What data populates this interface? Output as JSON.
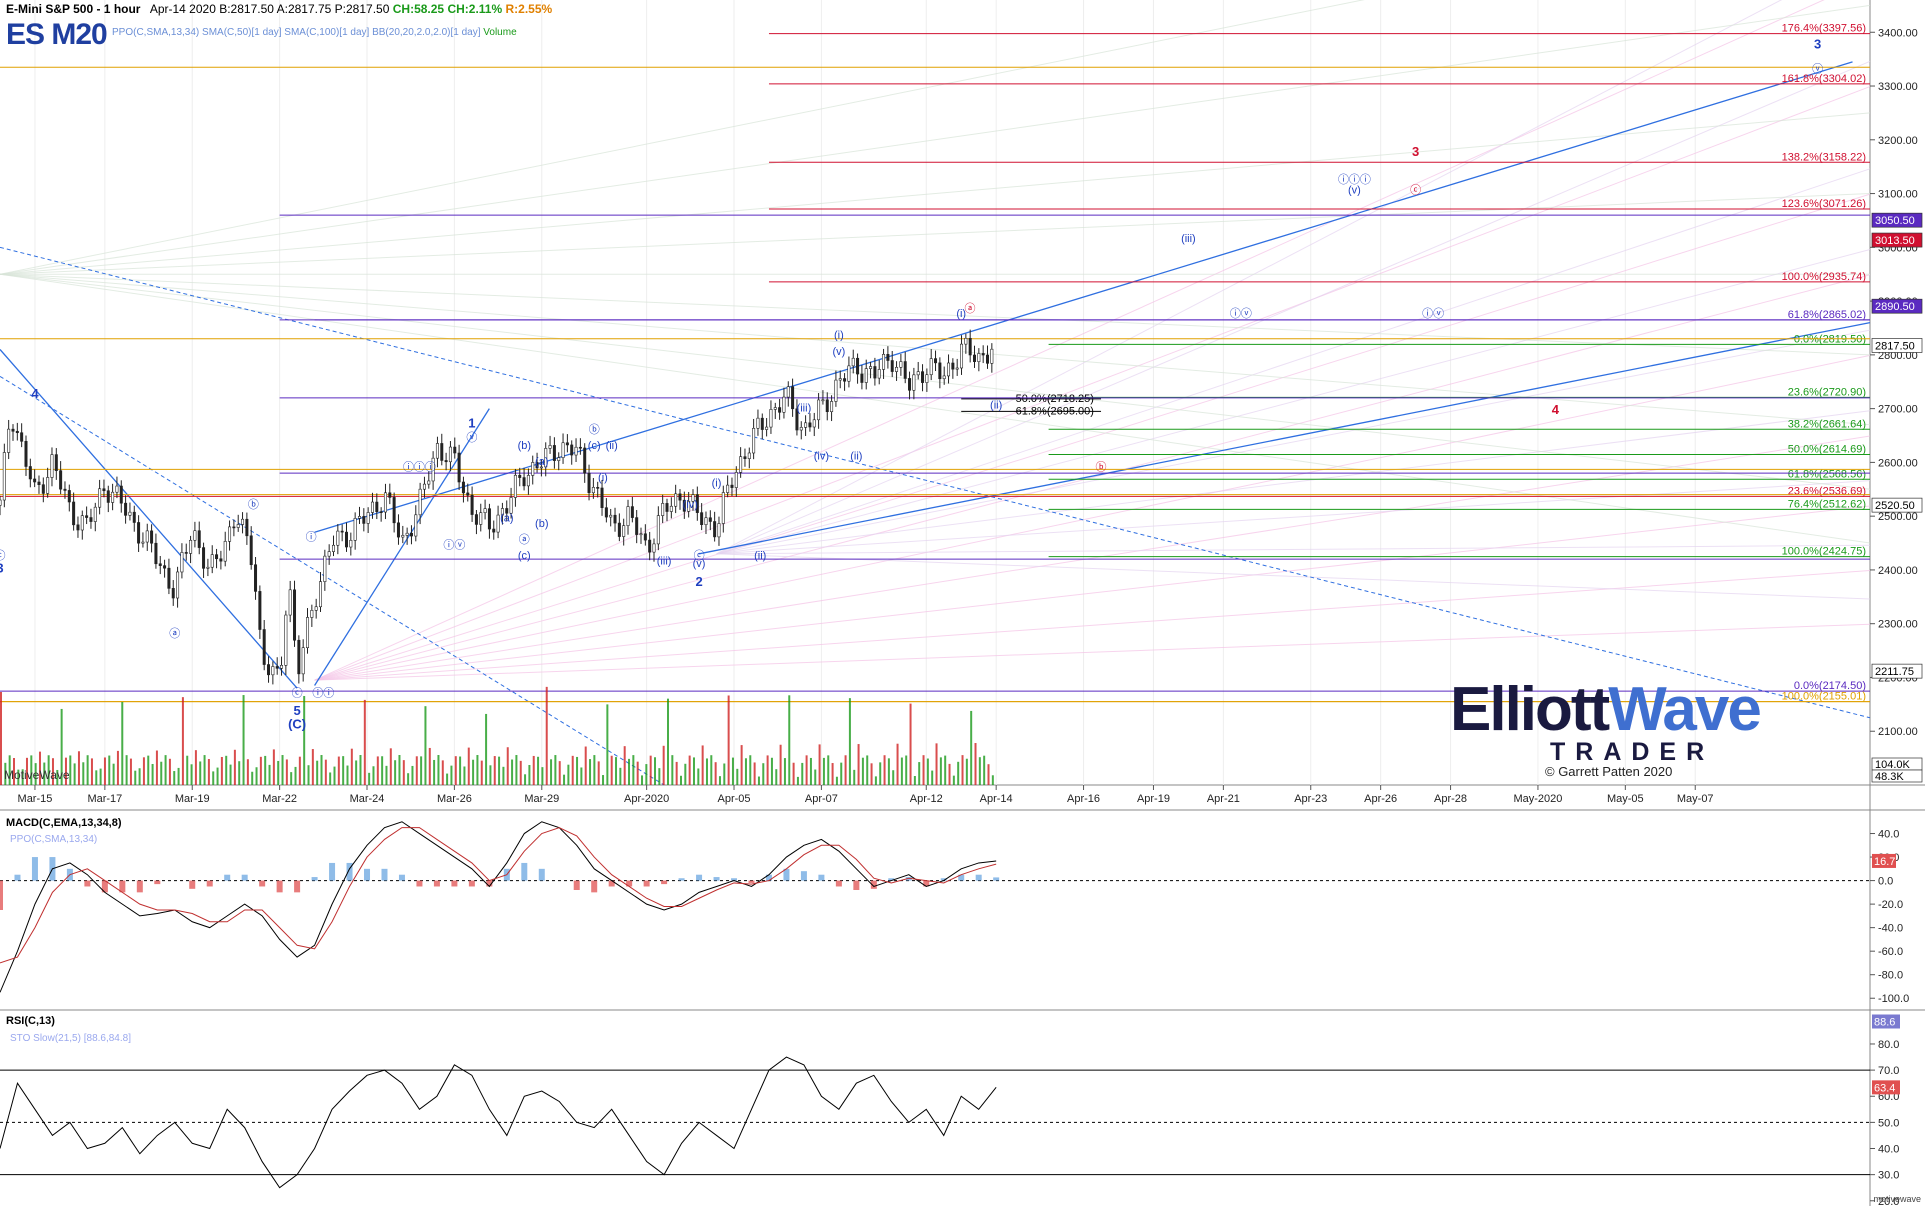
{
  "header": {
    "symbol_name": "E-Mini S&P 500 - 1 hour",
    "date": "Apr-14 2020",
    "bid": "B:2817.50",
    "ask": "A:2817.75",
    "price": "P:2817.50",
    "change": "CH:58.25",
    "change_pct": "CH:2.11%",
    "range": "R:2.55%",
    "ticker": "ES M20",
    "studies": "PPO(C,SMA,13,34)  SMA(C,50)[1 day]  SMA(C,100)[1 day]  BB(20,20,2.0,2.0)[1 day]",
    "volume_label": "Volume"
  },
  "branding": {
    "watermark": "MotiveWave",
    "footer": "motivewave",
    "logo_word1": "Elliott",
    "logo_word2": "Wave",
    "logo_sub": "TRADER",
    "copyright": "© Garrett Patten 2020"
  },
  "colors": {
    "up": "#1a9a1a",
    "down": "#d02020",
    "wave_blue": "#1f3fc0",
    "fib_red": "#d01030",
    "fib_purple": "#5a2ac0",
    "fib_orange": "#e0a000",
    "channel": "#2f6fe0"
  },
  "chart_data": [
    {
      "type": "candlestick",
      "title": "E-Mini S&P 500 - 1 hour",
      "ylim": [
        2000,
        3460
      ],
      "x_ticks": [
        "Mar-15",
        "Mar-17",
        "Mar-19",
        "Mar-22",
        "Mar-24",
        "Mar-26",
        "Mar-29",
        "Apr-2020",
        "Apr-05",
        "Apr-07",
        "Apr-12",
        "Apr-14",
        "Apr-16",
        "Apr-19",
        "Apr-21",
        "Apr-23",
        "Apr-26",
        "Apr-28",
        "May-2020",
        "May-05",
        "May-07"
      ],
      "x_tick_index": [
        2,
        6,
        11,
        16,
        21,
        26,
        31,
        37,
        42,
        47,
        53,
        57,
        62,
        66,
        70,
        75,
        79,
        83,
        88,
        93,
        97
      ],
      "x_domain": [
        0,
        107
      ],
      "y_ticks": [
        "3400.00",
        "3300.00",
        "3200.00",
        "3100.00",
        "3000.00",
        "2900.00",
        "2800.00",
        "2700.00",
        "2600.00",
        "2500.00",
        "2400.00",
        "2300.00",
        "2200.00",
        "2100.00"
      ],
      "y_tick_values": [
        3400,
        3300,
        3200,
        3100,
        3000,
        2900,
        2800,
        2700,
        2600,
        2500,
        2400,
        2300,
        2200,
        2100
      ],
      "closes_daily": [
        {
          "t": 0,
          "v": 2520
        },
        {
          "t": 0.6,
          "v": 2700
        },
        {
          "t": 1.3,
          "v": 2620
        },
        {
          "t": 2,
          "v": 2540
        },
        {
          "t": 3,
          "v": 2600
        },
        {
          "t": 4,
          "v": 2510
        },
        {
          "t": 5,
          "v": 2480
        },
        {
          "t": 6,
          "v": 2560
        },
        {
          "t": 7,
          "v": 2520
        },
        {
          "t": 8,
          "v": 2470
        },
        {
          "t": 9,
          "v": 2420
        },
        {
          "t": 10,
          "v": 2360
        },
        {
          "t": 11,
          "v": 2480
        },
        {
          "t": 12,
          "v": 2390
        },
        {
          "t": 13.5,
          "v": 2500
        },
        {
          "t": 14.5,
          "v": 2420
        },
        {
          "t": 15,
          "v": 2230
        },
        {
          "t": 16,
          "v": 2190
        },
        {
          "t": 16.5,
          "v": 2400
        },
        {
          "t": 17,
          "v": 2200
        },
        {
          "t": 18,
          "v": 2350
        },
        {
          "t": 19,
          "v": 2450
        },
        {
          "t": 20,
          "v": 2470
        },
        {
          "t": 21,
          "v": 2500
        },
        {
          "t": 22,
          "v": 2540
        },
        {
          "t": 23,
          "v": 2450
        },
        {
          "t": 24,
          "v": 2520
        },
        {
          "t": 25,
          "v": 2630
        },
        {
          "t": 26,
          "v": 2600
        },
        {
          "t": 27,
          "v": 2510
        },
        {
          "t": 28,
          "v": 2480
        },
        {
          "t": 29,
          "v": 2520
        },
        {
          "t": 30,
          "v": 2580
        },
        {
          "t": 31,
          "v": 2600
        },
        {
          "t": 32,
          "v": 2630
        },
        {
          "t": 33,
          "v": 2620
        },
        {
          "t": 34,
          "v": 2550
        },
        {
          "t": 35,
          "v": 2480
        },
        {
          "t": 36,
          "v": 2500
        },
        {
          "t": 37,
          "v": 2440
        },
        {
          "t": 38,
          "v": 2510
        },
        {
          "t": 39,
          "v": 2540
        },
        {
          "t": 40,
          "v": 2500
        },
        {
          "t": 41,
          "v": 2480
        },
        {
          "t": 42,
          "v": 2580
        },
        {
          "t": 43,
          "v": 2640
        },
        {
          "t": 44,
          "v": 2690
        },
        {
          "t": 45,
          "v": 2720
        },
        {
          "t": 46,
          "v": 2660
        },
        {
          "t": 47,
          "v": 2700
        },
        {
          "t": 48,
          "v": 2750
        },
        {
          "t": 49,
          "v": 2780
        },
        {
          "t": 50,
          "v": 2760
        },
        {
          "t": 51,
          "v": 2800
        },
        {
          "t": 52,
          "v": 2740
        },
        {
          "t": 53,
          "v": 2780
        },
        {
          "t": 54,
          "v": 2760
        },
        {
          "t": 55,
          "v": 2810
        },
        {
          "t": 56,
          "v": 2795
        },
        {
          "t": 57,
          "v": 2817.5
        }
      ],
      "fib_levels": [
        {
          "label": "176.4%(3397.56)",
          "value": 3397.56,
          "color": "#d01030",
          "start": 44
        },
        {
          "label": "161.8%(3304.02)",
          "value": 3304.02,
          "color": "#d01030",
          "start": 44
        },
        {
          "label": "138.2%(3158.22)",
          "value": 3158.22,
          "color": "#d01030",
          "start": 44
        },
        {
          "label": "123.6%(3071.26)",
          "value": 3071.26,
          "color": "#d01030",
          "start": 44
        },
        {
          "label": "100.0%(2935.74)",
          "value": 2935.74,
          "color": "#d01030",
          "start": 44
        },
        {
          "label": "61.8%(2865.02)",
          "value": 2865.02,
          "color": "#5a2ac0",
          "start": 18
        },
        {
          "label": "0.0%(2819.50)",
          "value": 2819.5,
          "color": "#1a9a1a",
          "start": 60
        },
        {
          "label": "23.6%(2720.90)",
          "value": 2720.9,
          "color": "#1a9a1a",
          "start": 60
        },
        {
          "label": "38.2%(2661.64)",
          "value": 2661.64,
          "color": "#1a9a1a",
          "start": 60
        },
        {
          "label": "50.0%(2614.69)",
          "value": 2614.69,
          "color": "#1a9a1a",
          "start": 60
        },
        {
          "label": "61.8%(2568.56)",
          "value": 2568.56,
          "color": "#1a9a1a",
          "start": 60
        },
        {
          "label": "23.6%(2536.69)",
          "value": 2536.69,
          "color": "#d01030",
          "start": 0
        },
        {
          "label": "76.4%(2512.62)",
          "value": 2512.62,
          "color": "#1a9a1a",
          "start": 60
        },
        {
          "label": "100.0%(2424.75)",
          "value": 2424.75,
          "color": "#1a9a1a",
          "start": 60
        },
        {
          "label": "0.0%(2174.50)",
          "value": 2174.5,
          "color": "#5a2ac0",
          "start": 0
        },
        {
          "label": "100.0%(2155.01)",
          "value": 2155.01,
          "color": "#e0a000",
          "start": 0
        }
      ],
      "inline_fibs": [
        {
          "label": "50.0%(2718.25)",
          "value": 2718.25
        },
        {
          "label": "61.8%(2695.00)",
          "value": 2695.0
        }
      ],
      "price_badges": [
        {
          "label": "3050.50",
          "value": 3050.5,
          "fill": "#5a2ac0"
        },
        {
          "label": "3013.50",
          "value": 3013.5,
          "fill": "#d01030"
        },
        {
          "label": "2890.50",
          "value": 2890.5,
          "fill": "#5a2ac0"
        },
        {
          "label": "2817.50",
          "value": 2817.5,
          "fill": "#ffffff"
        },
        {
          "label": "2520.50",
          "value": 2520.5,
          "fill": "#ffffff"
        },
        {
          "label": "2211.75",
          "value": 2211.75,
          "fill": "#ffffff"
        }
      ],
      "volume_badges": [
        "104.0K",
        "48.3K"
      ],
      "wave_labels": [
        {
          "text": "4",
          "t": 2,
          "v": 2720,
          "color": "#1f3fc0",
          "bold": true
        },
        {
          "text": "1",
          "t": 27,
          "v": 2665,
          "color": "#1f3fc0",
          "bold": true
        },
        {
          "text": "2",
          "t": 40,
          "v": 2370,
          "color": "#1f3fc0",
          "bold": true
        },
        {
          "text": "3",
          "t": 104,
          "v": 3370,
          "color": "#1f3fc0",
          "bold": true
        },
        {
          "text": "3",
          "t": 81,
          "v": 3170,
          "color": "#d01030",
          "bold": true
        },
        {
          "text": "4",
          "t": 89,
          "v": 2690,
          "color": "#d01030",
          "bold": true
        },
        {
          "text": "5",
          "t": 17,
          "v": 2130,
          "color": "#1f3fc0",
          "bold": true
        },
        {
          "text": "(C)",
          "t": 17,
          "v": 2105,
          "color": "#1f3fc0",
          "bold": true
        },
        {
          "text": "ⓒ",
          "t": 0,
          "v": 2420,
          "color": "#1f3fc0",
          "bold": false
        },
        {
          "text": "3",
          "t": 0,
          "v": 2395,
          "color": "#1f3fc0",
          "bold": true
        },
        {
          "text": "ⓑ",
          "t": 14.5,
          "v": 2515,
          "color": "#1f3fc0",
          "bold": false
        },
        {
          "text": "ⓐ",
          "t": 10,
          "v": 2275,
          "color": "#1f3fc0",
          "bold": false
        },
        {
          "text": "ⓒ",
          "t": 17,
          "v": 2165,
          "color": "#1f3fc0",
          "bold": false
        },
        {
          "text": "ⓘ",
          "t": 17.8,
          "v": 2455,
          "color": "#1f3fc0",
          "bold": false
        },
        {
          "text": "ⓘⓘ",
          "t": 18.5,
          "v": 2165,
          "color": "#1f3fc0",
          "bold": false
        },
        {
          "text": "ⓘⓘⓘ",
          "t": 24,
          "v": 2585,
          "color": "#1f3fc0",
          "bold": false
        },
        {
          "text": "ⓥ",
          "t": 27,
          "v": 2640,
          "color": "#1f3fc0",
          "bold": false
        },
        {
          "text": "ⓘⓥ",
          "t": 26,
          "v": 2440,
          "color": "#1f3fc0",
          "bold": false
        },
        {
          "text": "ⓑ",
          "t": 34,
          "v": 2655,
          "color": "#1f3fc0",
          "bold": false
        },
        {
          "text": "ⓐ",
          "t": 30,
          "v": 2450,
          "color": "#1f3fc0",
          "bold": false
        },
        {
          "text": "ⓒ",
          "t": 40,
          "v": 2420,
          "color": "#1f3fc0",
          "bold": false
        },
        {
          "text": "ⓐ",
          "t": 55.5,
          "v": 2880,
          "color": "#d01030",
          "bold": false
        },
        {
          "text": "ⓑ",
          "t": 63,
          "v": 2585,
          "color": "#d01030",
          "bold": false
        },
        {
          "text": "ⓒ",
          "t": 81,
          "v": 3100,
          "color": "#d01030",
          "bold": false
        },
        {
          "text": "ⓥ",
          "t": 104,
          "v": 3325,
          "color": "#1f3fc0",
          "bold": false
        },
        {
          "text": "ⓘⓥ",
          "t": 71,
          "v": 2870,
          "color": "#1f3fc0",
          "bold": false
        },
        {
          "text": "ⓘⓥ",
          "t": 82,
          "v": 2870,
          "color": "#1f3fc0",
          "bold": false
        },
        {
          "text": "ⓘⓘⓘ",
          "t": 77.5,
          "v": 3120,
          "color": "#1f3fc0",
          "bold": false
        },
        {
          "text": "(v)",
          "t": 77.5,
          "v": 3100,
          "color": "#1f3fc0",
          "bold": false
        },
        {
          "text": "(iii)",
          "t": 68,
          "v": 3010,
          "color": "#1f3fc0",
          "bold": false
        },
        {
          "text": "(i)",
          "t": 48,
          "v": 2830,
          "color": "#1f3fc0",
          "bold": false
        },
        {
          "text": "(v)",
          "t": 48,
          "v": 2800,
          "color": "#1f3fc0",
          "bold": false
        },
        {
          "text": "(i)",
          "t": 55,
          "v": 2870,
          "color": "#1f3fc0",
          "bold": false
        },
        {
          "text": "(ii)",
          "t": 57,
          "v": 2700,
          "color": "#1f3fc0",
          "bold": false
        },
        {
          "text": "(iii)",
          "t": 46,
          "v": 2695,
          "color": "#1f3fc0",
          "bold": false
        },
        {
          "text": "(iv)",
          "t": 47,
          "v": 2605,
          "color": "#1f3fc0",
          "bold": false
        },
        {
          "text": "(ii)",
          "t": 49,
          "v": 2605,
          "color": "#1f3fc0",
          "bold": false
        },
        {
          "text": "(i)",
          "t": 41,
          "v": 2555,
          "color": "#1f3fc0",
          "bold": false
        },
        {
          "text": "(iv)",
          "t": 39.5,
          "v": 2515,
          "color": "#1f3fc0",
          "bold": false
        },
        {
          "text": "(iii)",
          "t": 38,
          "v": 2410,
          "color": "#1f3fc0",
          "bold": false
        },
        {
          "text": "(v)",
          "t": 40,
          "v": 2405,
          "color": "#1f3fc0",
          "bold": false
        },
        {
          "text": "(ii)",
          "t": 43.5,
          "v": 2420,
          "color": "#1f3fc0",
          "bold": false
        },
        {
          "text": "(b)",
          "t": 30,
          "v": 2625,
          "color": "#1f3fc0",
          "bold": false
        },
        {
          "text": "(a)",
          "t": 31,
          "v": 2595,
          "color": "#1f3fc0",
          "bold": false
        },
        {
          "text": "(c)",
          "t": 34,
          "v": 2625,
          "color": "#1f3fc0",
          "bold": false
        },
        {
          "text": "(ii)",
          "t": 35,
          "v": 2625,
          "color": "#1f3fc0",
          "bold": false
        },
        {
          "text": "(i)",
          "t": 34.5,
          "v": 2565,
          "color": "#1f3fc0",
          "bold": false
        },
        {
          "text": "(a)",
          "t": 29,
          "v": 2490,
          "color": "#1f3fc0",
          "bold": false
        },
        {
          "text": "(b)",
          "t": 31,
          "v": 2480,
          "color": "#1f3fc0",
          "bold": false
        },
        {
          "text": "(c)",
          "t": 30,
          "v": 2420,
          "color": "#1f3fc0",
          "bold": false
        }
      ]
    },
    {
      "type": "line",
      "title": "MACD(C,EMA,13,34,8)",
      "subtitle": "PPO(C,SMA,13,34)",
      "ylim": [
        -110,
        60
      ],
      "y_ticks": [
        "40.0",
        "20.0",
        "0.0",
        "-20.0",
        "-40.0",
        "-60.0",
        "-80.0",
        "-100.0"
      ],
      "y_tick_values": [
        40,
        20,
        0,
        -20,
        -40,
        -60,
        -80,
        -100
      ],
      "last_value": "16.7",
      "macd": [
        -95,
        -60,
        -20,
        10,
        15,
        5,
        -10,
        -20,
        -30,
        -28,
        -25,
        -35,
        -40,
        -30,
        -20,
        -30,
        -50,
        -65,
        -55,
        -20,
        10,
        30,
        45,
        50,
        40,
        30,
        20,
        10,
        -5,
        15,
        40,
        50,
        45,
        30,
        10,
        0,
        -10,
        -20,
        -25,
        -20,
        -10,
        -5,
        0,
        -5,
        5,
        20,
        30,
        35,
        25,
        10,
        -5,
        0,
        5,
        -5,
        0,
        10,
        15,
        16.7
      ],
      "signal": [
        -70,
        -65,
        -40,
        -10,
        5,
        10,
        0,
        -10,
        -20,
        -25,
        -25,
        -28,
        -35,
        -35,
        -25,
        -25,
        -40,
        -55,
        -58,
        -35,
        -5,
        20,
        35,
        45,
        45,
        35,
        25,
        15,
        0,
        5,
        25,
        40,
        45,
        38,
        20,
        5,
        -5,
        -15,
        -22,
        -22,
        -15,
        -8,
        -2,
        -3,
        0,
        10,
        22,
        30,
        30,
        18,
        2,
        -2,
        2,
        0,
        -2,
        5,
        10,
        14
      ]
    },
    {
      "type": "line",
      "title": "RSI(C,13)",
      "subtitle": "STO Slow(21,5) [88.6,84.8]",
      "ylim": [
        18,
        93
      ],
      "y_ticks": [
        "80.0",
        "70.0",
        "60.0",
        "50.0",
        "40.0",
        "30.0",
        "20.0"
      ],
      "y_tick_values": [
        80,
        70,
        60,
        50,
        40,
        30,
        20
      ],
      "bands": [
        70,
        50,
        30
      ],
      "badges": [
        {
          "label": "88.6",
          "value": 88.6
        },
        {
          "label": "63.4",
          "value": 63.4
        }
      ],
      "rsi": [
        40,
        65,
        55,
        45,
        50,
        40,
        42,
        48,
        38,
        45,
        50,
        42,
        40,
        55,
        48,
        35,
        25,
        30,
        40,
        55,
        62,
        68,
        70,
        65,
        55,
        60,
        72,
        68,
        55,
        45,
        60,
        62,
        58,
        50,
        48,
        55,
        45,
        35,
        30,
        42,
        50,
        45,
        40,
        55,
        70,
        75,
        72,
        60,
        55,
        65,
        68,
        58,
        50,
        55,
        45,
        60,
        55,
        63.4
      ]
    }
  ]
}
